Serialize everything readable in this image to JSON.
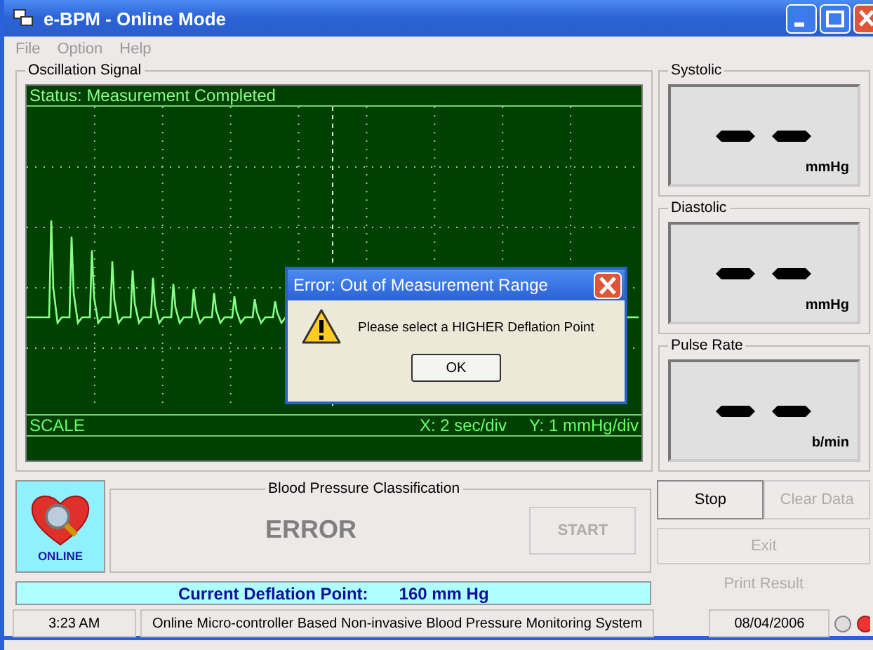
{
  "window": {
    "title": "e-BPM - Online Mode"
  },
  "menu": [
    {
      "label": "File",
      "disabled": true
    },
    {
      "label": "Option",
      "disabled": true
    },
    {
      "label": "Help",
      "disabled": true
    }
  ],
  "oscillation": {
    "title": "Oscillation Signal",
    "status": "Status: Measurement Completed",
    "scale_label": "SCALE",
    "x_scale": "X: 2 sec/div",
    "y_scale": "Y: 1 mmHg/div"
  },
  "readings": [
    {
      "title": "Systolic",
      "unit": "mmHg"
    },
    {
      "title": "Diastolic",
      "unit": "mmHg"
    },
    {
      "title": "Pulse Rate",
      "unit": "b/min"
    }
  ],
  "mode_badge": "ONLINE",
  "classification": {
    "title": "Blood Pressure Classification",
    "result": "ERROR",
    "start_button": {
      "label": "START",
      "disabled": true
    }
  },
  "buttons": [
    {
      "label": "Stop",
      "disabled": false
    },
    {
      "label": "Clear Data",
      "disabled": true
    },
    {
      "label": "Exit",
      "disabled": true
    },
    {
      "label": "Print Result",
      "disabled": true
    }
  ],
  "deflation": {
    "label": "Current Deflation Point:",
    "value": "160 mm Hg"
  },
  "status_bar": {
    "time": "3:23 AM",
    "message": "Online Micro-controller Based Non-invasive Blood Pressure Monitoring System",
    "date": "08/04/2006"
  },
  "dialog": {
    "title": "Error: Out of Measurement Range",
    "message": "Please select a HIGHER Deflation Point",
    "button": "OK"
  }
}
